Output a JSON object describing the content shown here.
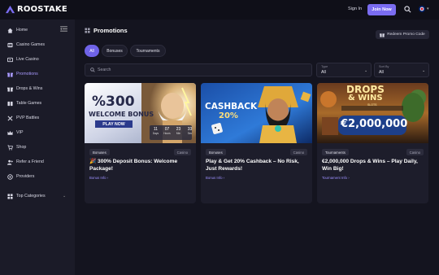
{
  "header": {
    "brand": "ROOSTAKE",
    "sign_in": "Sign In",
    "join_now": "Join Now",
    "language_chevron": "▾"
  },
  "sidebar": {
    "items": [
      {
        "label": "Home",
        "icon": "home-icon"
      },
      {
        "label": "Casino Games",
        "icon": "slot-icon"
      },
      {
        "label": "Live Casino",
        "icon": "live-icon"
      },
      {
        "label": "Promotions",
        "icon": "promo-icon",
        "active": true
      },
      {
        "label": "Drops & Wins",
        "icon": "drops-icon"
      },
      {
        "label": "Table Games",
        "icon": "table-icon"
      },
      {
        "label": "PVP Battles",
        "icon": "pvp-icon"
      },
      {
        "label": "VIP",
        "icon": "vip-icon"
      },
      {
        "label": "Shop",
        "icon": "shop-icon"
      },
      {
        "label": "Refer a Friend",
        "icon": "refer-icon"
      },
      {
        "label": "Providers",
        "icon": "providers-icon"
      },
      {
        "label": "Top Categories",
        "icon": "categories-icon",
        "chevron": "⌄"
      }
    ]
  },
  "main": {
    "title": "Promotions",
    "redeem_label": "Redeem Promo Code",
    "tabs": [
      "All",
      "Bonuses",
      "Tournaments"
    ],
    "search_placeholder": "Search",
    "filters": [
      {
        "caption": "Type",
        "value": "All"
      },
      {
        "caption": "Sort By",
        "value": "All"
      }
    ],
    "cards": [
      {
        "category": "Bonuses",
        "type": "Casino",
        "title": "🎉 300% Deposit Bonus: Welcome Package!",
        "link": "Bonus Info ›",
        "banner": {
          "big": "%300",
          "mid": "WELCOME BONUS",
          "cta": "PLAY NOW",
          "countdown": [
            "11",
            "07",
            "23",
            "33"
          ],
          "countdown_labels": [
            "Days",
            "Hours",
            "Min",
            "Sec"
          ]
        }
      },
      {
        "category": "Bonuses",
        "type": "Casino",
        "title": "Play & Get 20% Cashback – No Risk, Just Rewards!",
        "link": "Bonus Info ›",
        "banner": {
          "big": "CASHBACK",
          "mid": "20%"
        }
      },
      {
        "category": "Tournaments",
        "type": "Casino",
        "title": "€2,000,000 Drops & Wins – Play Daily, Win Big!",
        "link": "Tournament Info ›",
        "banner": {
          "big": "DROPS",
          "amp": "& WINS",
          "slots": "SLOTS",
          "amount": "€2,000,000"
        }
      }
    ]
  },
  "colors": {
    "accent": "#7a6cf0",
    "bg": "#14141f",
    "sidebar": "#1b1b28",
    "card": "#1d1d2b"
  }
}
